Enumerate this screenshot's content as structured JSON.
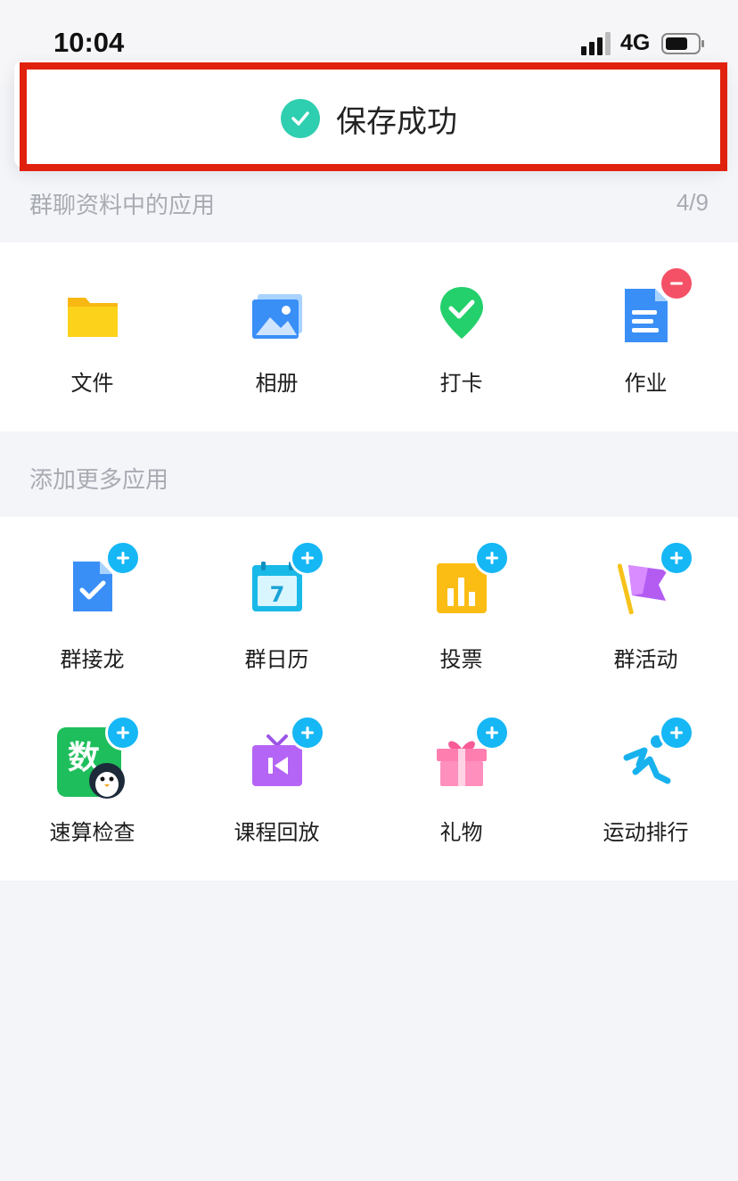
{
  "status_bar": {
    "time": "10:04",
    "network": "4G"
  },
  "toast": {
    "text": "保存成功"
  },
  "group_apps": {
    "title": "群聊资料中的应用",
    "count": "4/9",
    "items": [
      {
        "label": "文件",
        "icon": "folder-icon"
      },
      {
        "label": "相册",
        "icon": "photo-album-icon"
      },
      {
        "label": "打卡",
        "icon": "check-in-pin-icon"
      },
      {
        "label": "作业",
        "icon": "homework-doc-icon"
      }
    ]
  },
  "more_apps": {
    "title": "添加更多应用",
    "items": [
      {
        "label": "群接龙",
        "icon": "relay-doc-icon"
      },
      {
        "label": "群日历",
        "icon": "calendar-icon"
      },
      {
        "label": "投票",
        "icon": "vote-chart-icon"
      },
      {
        "label": "群活动",
        "icon": "activity-flag-icon"
      },
      {
        "label": "速算检查",
        "icon": "math-check-icon"
      },
      {
        "label": "课程回放",
        "icon": "course-replay-icon"
      },
      {
        "label": "礼物",
        "icon": "gift-icon"
      },
      {
        "label": "运动排行",
        "icon": "sports-rank-icon"
      }
    ]
  },
  "colors": {
    "toast_highlight": "#e0210e",
    "add_badge": "#16b7f5",
    "remove_badge": "#f45166",
    "check": "#2ecfb0"
  },
  "calendar_icon_day": "7",
  "math_icon_char": "数"
}
